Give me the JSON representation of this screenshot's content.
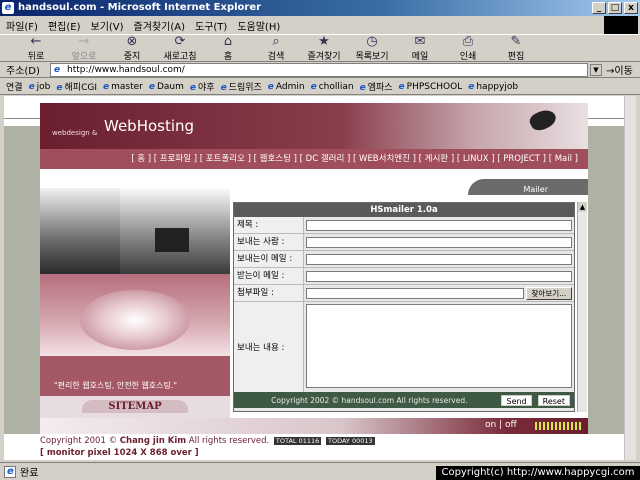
{
  "window": {
    "title": "handsoul.com - Microsoft Internet Explorer",
    "controls": [
      "_",
      "□",
      "x"
    ]
  },
  "menu": [
    "파일(F)",
    "편집(E)",
    "보기(V)",
    "즐겨찾기(A)",
    "도구(T)",
    "도움말(H)"
  ],
  "toolbar": [
    {
      "label": "뒤로",
      "icon": "back-arrow-icon",
      "glyph": "←",
      "disabled": false
    },
    {
      "label": "앞으로",
      "icon": "forward-arrow-icon",
      "glyph": "→",
      "disabled": true
    },
    {
      "label": "중지",
      "icon": "stop-icon",
      "glyph": "⊗",
      "disabled": false
    },
    {
      "label": "새로고침",
      "icon": "refresh-icon",
      "glyph": "⟳",
      "disabled": false
    },
    {
      "label": "홈",
      "icon": "home-icon",
      "glyph": "⌂",
      "disabled": false
    },
    {
      "label": "검색",
      "icon": "search-icon",
      "glyph": "⌕",
      "disabled": false
    },
    {
      "label": "즐겨찾기",
      "icon": "favorites-icon",
      "glyph": "★",
      "disabled": false
    },
    {
      "label": "목록보기",
      "icon": "history-icon",
      "glyph": "◷",
      "disabled": false
    },
    {
      "label": "메일",
      "icon": "mail-icon",
      "glyph": "✉",
      "disabled": false
    },
    {
      "label": "인쇄",
      "icon": "print-icon",
      "glyph": "⎙",
      "disabled": false
    },
    {
      "label": "편집",
      "icon": "edit-icon",
      "glyph": "✎",
      "disabled": false
    }
  ],
  "address": {
    "label": "주소(D)",
    "url": "http://www.handsoul.com/",
    "go_label": "이동"
  },
  "links": {
    "label": "연결",
    "items": [
      "job",
      "해피CGI",
      "master",
      "Daum",
      "야후",
      "드림위즈",
      "Admin",
      "chollian",
      "엠파스",
      "PHPSCHOOL",
      "happyjob"
    ]
  },
  "site": {
    "header_small": "webdesign &",
    "header_big": "WebHosting",
    "nav": "[ 홈 ] [ 프로파일 ] [ 포트폴리오 ] [ 웹호스팅 ] [ DC 갤러리 ] [ WEB서치엔진 ] [ 게시판 ] [ LINUX ] [ PROJECT ] [ Mail ]",
    "mailer_tab": "Mailer",
    "slogan": "\"편리한 웹호스팅, 안전한 웹호스팅.\"",
    "sitemap": "SITEMAP",
    "onoff": "on | off"
  },
  "mailer": {
    "title": "HSmailer 1.0a",
    "fields": [
      {
        "label": "제목 :",
        "value": ""
      },
      {
        "label": "보내는 사람 :",
        "value": ""
      },
      {
        "label": "보내는이 메일 :",
        "value": ""
      },
      {
        "label": "받는이 메일 :",
        "value": ""
      }
    ],
    "attach_label": "첨부파일 :",
    "browse_button": "찾아보기...",
    "body_label": "보내는 내용 :",
    "body_value": "",
    "copyright": "Copyright 2002 © handsoul.com All rights reserved.",
    "send_button": "Send",
    "reset_button": "Reset"
  },
  "footer": {
    "line1_prefix": "Copyright 2001 © ",
    "author": "Chang jin Kim",
    "line1_suffix": " All rights reserved.",
    "total_label": "TOTAL",
    "total_value": "01116",
    "today_label": "TODAY",
    "today_value": "00013",
    "line2": "[ monitor pixel 1024 X 868 over ]"
  },
  "status": {
    "text": "완료"
  },
  "overlay": "Copyright(c) http://www.happycgi.com"
}
